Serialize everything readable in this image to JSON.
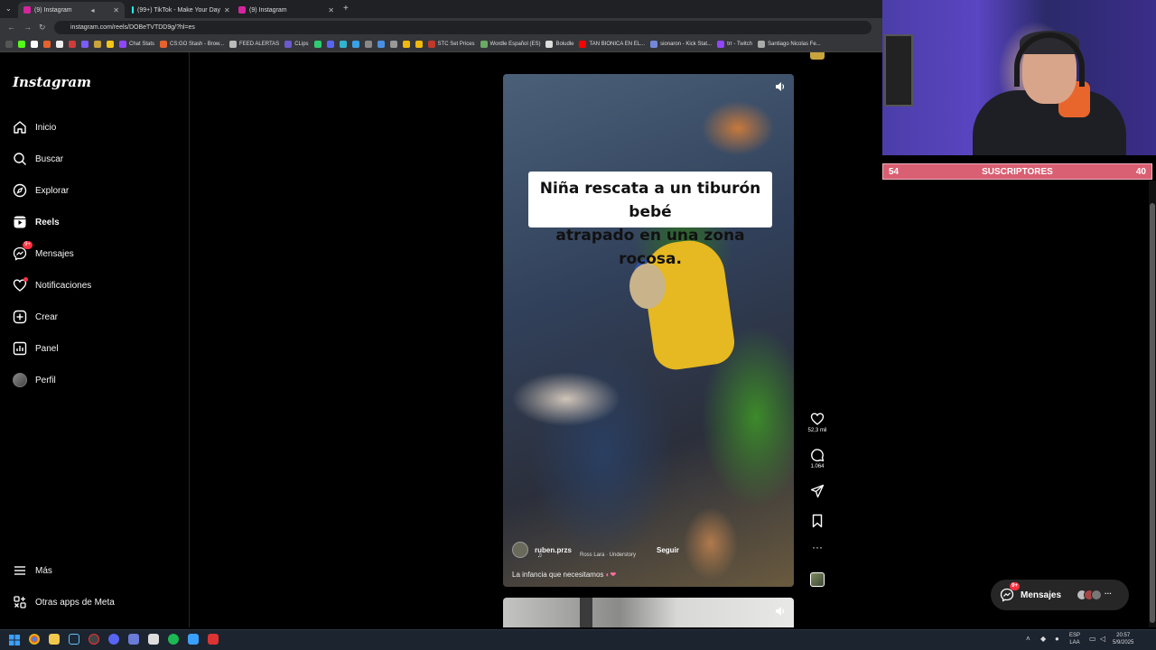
{
  "browser": {
    "tabs": [
      {
        "label": "(9) Instagram",
        "active": true
      },
      {
        "label": "(99+) TikTok - Make Your Day",
        "active": false
      },
      {
        "label": "(9) Instagram",
        "active": false
      }
    ],
    "new_tab": "+",
    "url": "instagram.com/reels/DOBeTVTDD9g/?hl=es",
    "bookmarks": [
      "Chat Stats",
      "CS:GO Stash - Brow...",
      "FEED ALERTAS",
      "CLips",
      "STC Set Prices",
      "Wordle Español (ES)",
      "Boludle",
      "TAN BIONICA EN EL...",
      "sionaron - Kick Stat...",
      "trr - Twitch",
      "Santiago Nicolas Fe..."
    ]
  },
  "sidebar": {
    "logo": "Instagram",
    "items": [
      {
        "label": "Inicio",
        "icon": "home-icon"
      },
      {
        "label": "Buscar",
        "icon": "search-icon"
      },
      {
        "label": "Explorar",
        "icon": "compass-icon"
      },
      {
        "label": "Reels",
        "icon": "reels-icon",
        "active": true
      },
      {
        "label": "Mensajes",
        "icon": "messenger-icon",
        "badge": "9+"
      },
      {
        "label": "Notificaciones",
        "icon": "heart-icon"
      },
      {
        "label": "Crear",
        "icon": "plus-square-icon"
      },
      {
        "label": "Panel",
        "icon": "chart-icon"
      },
      {
        "label": "Perfil",
        "icon": "avatar"
      }
    ],
    "more": "Más",
    "meta": "Otras apps de Meta"
  },
  "reel": {
    "caption_line1": "Niña rescata a un tiburón bebé",
    "caption_line2": "atrapado en una zona rocosa.",
    "username": "ruben.przs",
    "follow": "Seguir",
    "audio": "Ross Lara · Understory",
    "description": "La infancia que necesitamos",
    "likes": "52,3 mil",
    "comments": "1.064"
  },
  "messages_pill": {
    "label": "Mensajes",
    "badge": "9+"
  },
  "overlay": {
    "subs_left": "54",
    "subs_label": "SUSCRIPTORES",
    "subs_right": "40"
  },
  "taskbar": {
    "lang_top": "ESP",
    "lang_bottom": "LAA",
    "time": "20:57",
    "date": "5/9/2025"
  },
  "colors": {
    "accent_red": "#ff3040",
    "subs_bar": "#d95f72",
    "background": "#000000"
  }
}
